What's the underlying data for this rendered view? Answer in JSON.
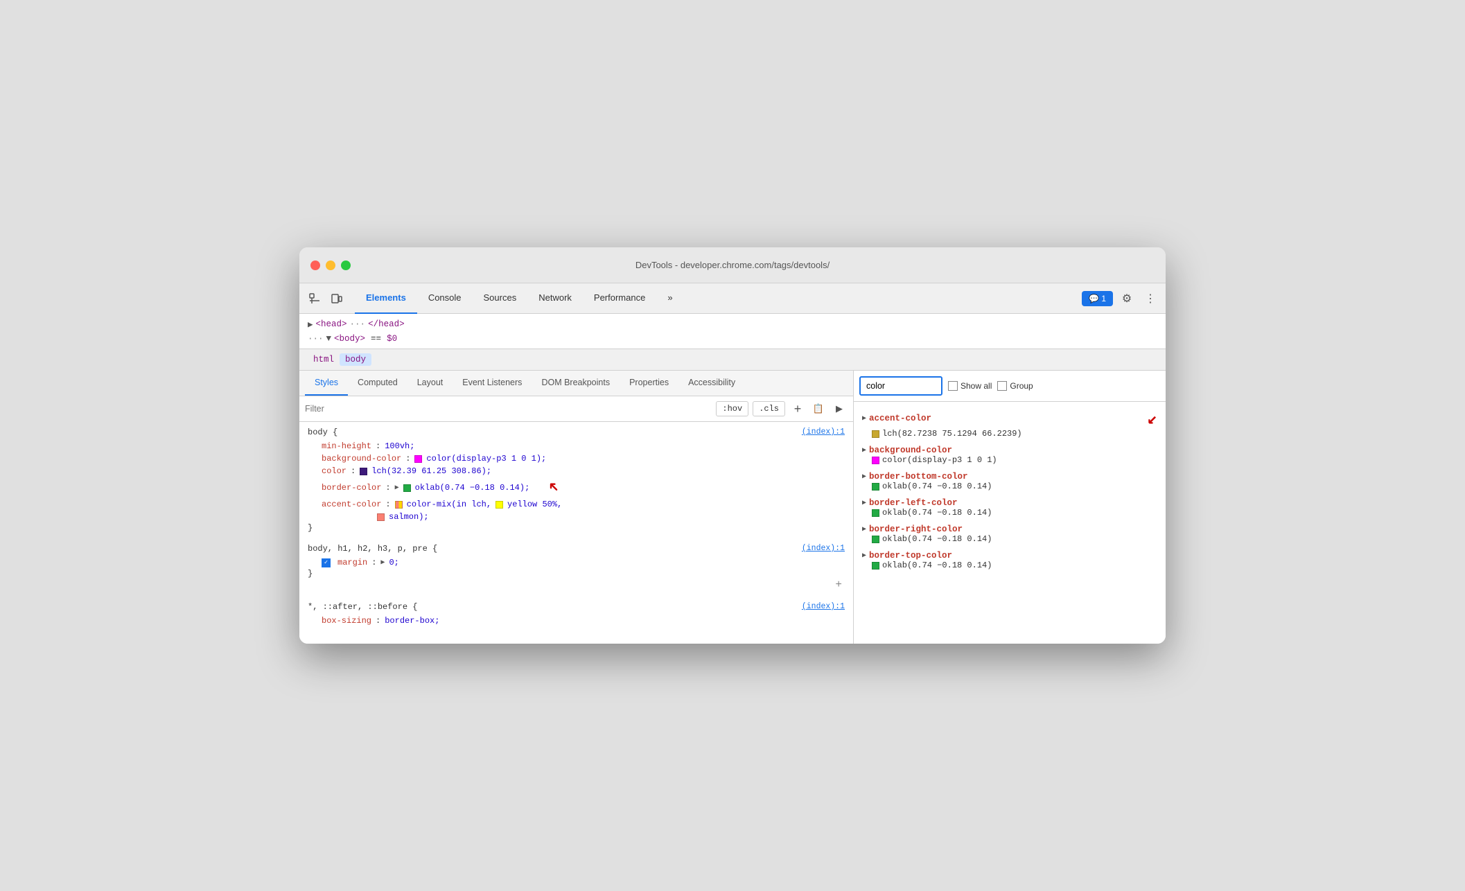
{
  "window": {
    "title": "DevTools - developer.chrome.com/tags/devtools/"
  },
  "toolbar": {
    "tabs": [
      {
        "id": "elements",
        "label": "Elements",
        "active": true
      },
      {
        "id": "console",
        "label": "Console",
        "active": false
      },
      {
        "id": "sources",
        "label": "Sources",
        "active": false
      },
      {
        "id": "network",
        "label": "Network",
        "active": false
      },
      {
        "id": "performance",
        "label": "Performance",
        "active": false
      },
      {
        "id": "more",
        "label": "»",
        "active": false
      }
    ],
    "chat_badge": "💬 1",
    "settings_icon": "⚙",
    "more_icon": "⋮"
  },
  "html_tree": {
    "head_line": "▶ <head> ··· </head>",
    "body_line": "··· ▼ <body> == $0"
  },
  "breadcrumb": {
    "items": [
      "html",
      "body"
    ]
  },
  "sub_tabs": [
    {
      "id": "styles",
      "label": "Styles",
      "active": true
    },
    {
      "id": "computed",
      "label": "Computed",
      "active": false
    },
    {
      "id": "layout",
      "label": "Layout",
      "active": false
    },
    {
      "id": "event-listeners",
      "label": "Event Listeners",
      "active": false
    },
    {
      "id": "dom-breakpoints",
      "label": "DOM Breakpoints",
      "active": false
    },
    {
      "id": "properties",
      "label": "Properties",
      "active": false
    },
    {
      "id": "accessibility",
      "label": "Accessibility",
      "active": false
    }
  ],
  "filter": {
    "placeholder": "Filter",
    "hov_btn": ":hov",
    "cls_btn": ".cls",
    "plus_icon": "+",
    "new_rule_icon": "📋",
    "toggle_icon": "▶"
  },
  "css_rules": [
    {
      "id": "rule1",
      "selector": "body {",
      "file_link": "(index):1",
      "props": [
        {
          "name": "min-height",
          "colon": ":",
          "value": "100vh;",
          "swatch": null,
          "checkbox": false,
          "has_triangle": false
        },
        {
          "name": "background-color",
          "colon": ":",
          "value": "color(display-p3 1 0 1);",
          "swatch": {
            "color": "#ff00ff"
          },
          "checkbox": false,
          "has_triangle": false
        },
        {
          "name": "color",
          "colon": ":",
          "value": "lch(32.39 61.25 308.86);",
          "swatch": {
            "color": "#3d1a7a"
          },
          "checkbox": false,
          "has_triangle": false
        },
        {
          "name": "border-color",
          "colon": ":",
          "value": "oklab(0.74 −0.18 0.14);",
          "swatch": {
            "color": "#22aa44"
          },
          "checkbox": false,
          "has_triangle": true
        },
        {
          "name": "accent-color",
          "colon": ":",
          "value": "color-mix(in lch,",
          "swatch_mixed": true,
          "value2": "yellow 50%,",
          "value3": "salmon);",
          "checkbox": false,
          "has_triangle": false,
          "has_yellow": true
        }
      ],
      "close": "}"
    },
    {
      "id": "rule2",
      "selector": "body, h1, h2, h3, p, pre {",
      "file_link": "(index):1",
      "props": [
        {
          "name": "margin",
          "colon": ":",
          "value": "▶ 0;",
          "swatch": null,
          "checkbox": true,
          "has_triangle": false
        }
      ],
      "close": "}"
    },
    {
      "id": "rule3",
      "selector": "*, ::after, ::before {",
      "file_link": "(index):1",
      "props": [
        {
          "name": "box-sizing",
          "colon": ":",
          "value": "border-box;",
          "swatch": null,
          "checkbox": false,
          "has_triangle": false,
          "truncated": true
        }
      ],
      "close": null
    }
  ],
  "computed": {
    "search_placeholder": "color",
    "search_value": "color",
    "show_all_label": "Show all",
    "group_label": "Group",
    "props": [
      {
        "id": "accent-color",
        "name": "accent-color",
        "swatch_color": "#c8a830",
        "value": "lch(82.7238 75.1294 66.2239)"
      },
      {
        "id": "background-color",
        "name": "background-color",
        "swatch_color": "#ff00ff",
        "value": "color(display-p3 1 0 1)"
      },
      {
        "id": "border-bottom-color",
        "name": "border-bottom-color",
        "swatch_color": "#22aa44",
        "value": "oklab(0.74 −0.18 0.14)"
      },
      {
        "id": "border-left-color",
        "name": "border-left-color",
        "swatch_color": "#22aa44",
        "value": "oklab(0.74 −0.18 0.14)"
      },
      {
        "id": "border-right-color",
        "name": "border-right-color",
        "swatch_color": "#22aa44",
        "value": "oklab(0.74 −0.18 0.14)"
      },
      {
        "id": "border-top-color",
        "name": "border-top-color",
        "swatch_color": "#22aa44",
        "value": "oklab(0.74 −0.18 0.14)"
      }
    ]
  }
}
